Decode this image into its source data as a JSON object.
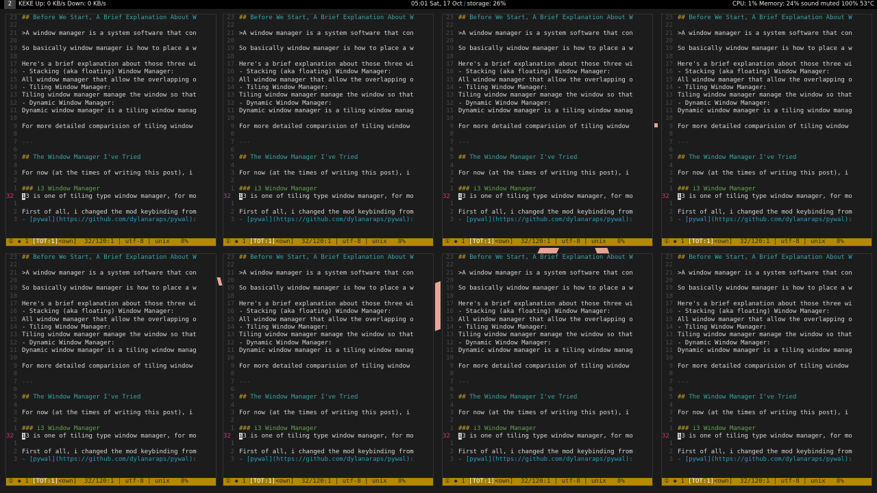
{
  "bar": {
    "workspace": "2",
    "network": "KEKE Up:  0 KB/s  Down: 0 KB/s",
    "datetime": "05:01 Sat, 17 Oct",
    "storage": "storage: 26%",
    "status_right": "CPU:  1% Memory: 24%  sound muted 100% 53°C"
  },
  "colors": {
    "background": "#1b1b1b",
    "heading": "#3aa6a6",
    "hash": "#c7a52e",
    "h3": "#5fa84f",
    "statusline": "#b58900",
    "current_line_number": "#d33682",
    "wallpaper_accent": "#e8a595"
  },
  "editor": {
    "lines": [
      {
        "n": "23",
        "kind": "hd",
        "hash": "## ",
        "text": "Before We Start, A Brief Explanation About W"
      },
      {
        "n": "22",
        "kind": "blank",
        "text": ""
      },
      {
        "n": "21",
        "kind": "txt",
        "text": ">A window manager is a system software that con"
      },
      {
        "n": "20",
        "kind": "blank",
        "text": ""
      },
      {
        "n": "19",
        "kind": "txt",
        "text": "So basically window manager is how to place a w"
      },
      {
        "n": "18",
        "kind": "blank",
        "text": ""
      },
      {
        "n": "17",
        "kind": "txt",
        "text": "Here's a brief explanation about those three wi"
      },
      {
        "n": "16",
        "kind": "txt",
        "text": "- Stacking (aka floating) Window Manager:"
      },
      {
        "n": "15",
        "kind": "txt",
        "text": "All window manager that allow the overlapping o"
      },
      {
        "n": "14",
        "kind": "txt",
        "text": "- Tiling Window Manager:"
      },
      {
        "n": "13",
        "kind": "txt",
        "text": "Tiling window manager manage the window so that"
      },
      {
        "n": "12",
        "kind": "txt",
        "text": "- Dynamic Window Manager:"
      },
      {
        "n": "11",
        "kind": "txt",
        "text": "Dynamic window manager is a tiling window manag"
      },
      {
        "n": "10",
        "kind": "blank",
        "text": ""
      },
      {
        "n": "9",
        "kind": "txt",
        "text": "For more detailed comparision of tiling window"
      },
      {
        "n": "8",
        "kind": "blank",
        "text": ""
      },
      {
        "n": "7",
        "kind": "dim",
        "text": "---"
      },
      {
        "n": "6",
        "kind": "blank",
        "text": ""
      },
      {
        "n": "5",
        "kind": "hd",
        "hash": "## ",
        "text": "The Window Manager I've Tried"
      },
      {
        "n": "4",
        "kind": "blank",
        "text": ""
      },
      {
        "n": "3",
        "kind": "txt",
        "text": "For now (at the times of writing this post), i"
      },
      {
        "n": "2",
        "kind": "blank",
        "text": ""
      },
      {
        "n": "1",
        "kind": "h3",
        "hash": "### ",
        "text": "i3 Window Manager"
      },
      {
        "n": "32",
        "kind": "cur",
        "cursor": "i",
        "text": "3 is one of tiling type window manager, for mo"
      },
      {
        "n": "1",
        "kind": "blank",
        "text": ""
      },
      {
        "n": "2",
        "kind": "txt",
        "text": "First of all, i changed the mod keybinding from"
      },
      {
        "n": "3",
        "kind": "link",
        "text": "- [pywal](https://github.com/dylanaraps/pywal):"
      }
    ],
    "status": {
      "left": "① ◆ 1 ",
      "tot": "[TOT:1]",
      "rest": "<own]  32/120:1 | utf-8 | unix   8%"
    }
  },
  "panes": [
    "pane-1",
    "pane-2",
    "pane-3",
    "pane-4",
    "pane-5",
    "pane-6",
    "pane-7",
    "pane-8"
  ]
}
